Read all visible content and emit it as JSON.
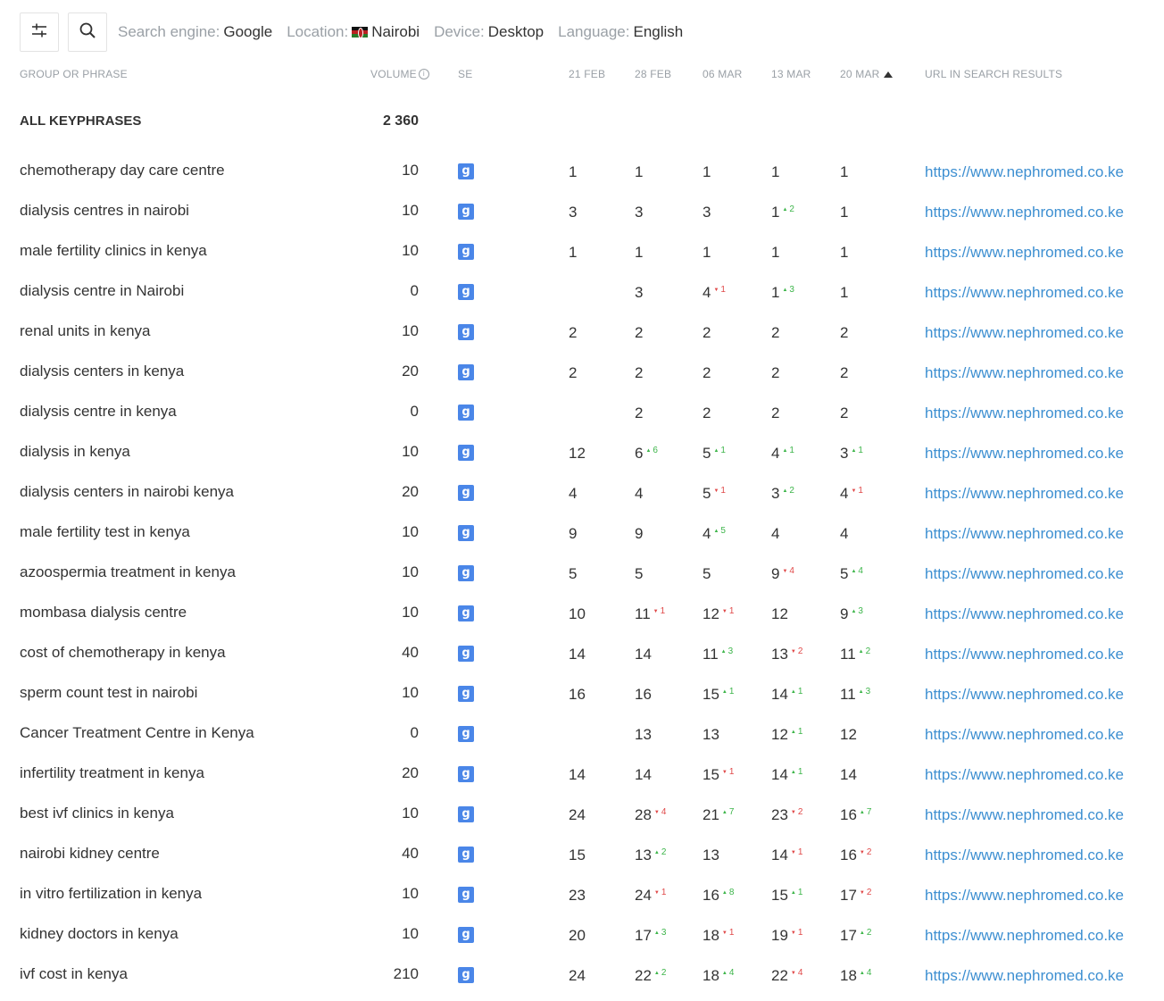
{
  "toolbar": {
    "filter_settings_icon": "sliders-icon",
    "search_icon": "search-icon",
    "search_engine_label": "Search engine:",
    "search_engine": "Google",
    "location_label": "Location:",
    "location": "Nairobi",
    "device_label": "Device:",
    "device": "Desktop",
    "language_label": "Language:",
    "language": "English"
  },
  "columns": {
    "phrase": "GROUP OR PHRASE",
    "volume": "VOLUME",
    "se": "SE",
    "dates": [
      "21 FEB",
      "28 FEB",
      "06 MAR",
      "13 MAR",
      "20 MAR"
    ],
    "url": "URL IN SEARCH RESULTS"
  },
  "summary": {
    "label": "ALL KEYPHRASES",
    "volume": "2 360"
  },
  "se_icon_letter": "g",
  "colors": {
    "up": "#3db54a",
    "down": "#e04848",
    "link": "#3d8fd1",
    "se_badge": "#4a86e8"
  },
  "rows": [
    {
      "phrase": "chemotherapy day care centre",
      "volume": "10",
      "pos": [
        {
          "v": "1"
        },
        {
          "v": "1"
        },
        {
          "v": "1"
        },
        {
          "v": "1"
        },
        {
          "v": "1"
        }
      ],
      "url": "https://www.nephromed.co.ke"
    },
    {
      "phrase": "dialysis centres in nairobi",
      "volume": "10",
      "pos": [
        {
          "v": "3"
        },
        {
          "v": "3"
        },
        {
          "v": "3"
        },
        {
          "v": "1",
          "c": "2",
          "d": "up"
        },
        {
          "v": "1"
        }
      ],
      "url": "https://www.nephromed.co.ke"
    },
    {
      "phrase": "male fertility clinics in kenya",
      "volume": "10",
      "pos": [
        {
          "v": "1"
        },
        {
          "v": "1"
        },
        {
          "v": "1"
        },
        {
          "v": "1"
        },
        {
          "v": "1"
        }
      ],
      "url": "https://www.nephromed.co.ke"
    },
    {
      "phrase": "dialysis centre in Nairobi",
      "volume": "0",
      "pos": [
        {
          "v": ""
        },
        {
          "v": "3"
        },
        {
          "v": "4",
          "c": "1",
          "d": "down"
        },
        {
          "v": "1",
          "c": "3",
          "d": "up"
        },
        {
          "v": "1"
        }
      ],
      "url": "https://www.nephromed.co.ke"
    },
    {
      "phrase": "renal units in kenya",
      "volume": "10",
      "pos": [
        {
          "v": "2"
        },
        {
          "v": "2"
        },
        {
          "v": "2"
        },
        {
          "v": "2"
        },
        {
          "v": "2"
        }
      ],
      "url": "https://www.nephromed.co.ke"
    },
    {
      "phrase": "dialysis centers in kenya",
      "volume": "20",
      "pos": [
        {
          "v": "2"
        },
        {
          "v": "2"
        },
        {
          "v": "2"
        },
        {
          "v": "2"
        },
        {
          "v": "2"
        }
      ],
      "url": "https://www.nephromed.co.ke"
    },
    {
      "phrase": "dialysis centre in kenya",
      "volume": "0",
      "pos": [
        {
          "v": ""
        },
        {
          "v": "2"
        },
        {
          "v": "2"
        },
        {
          "v": "2"
        },
        {
          "v": "2"
        }
      ],
      "url": "https://www.nephromed.co.ke"
    },
    {
      "phrase": "dialysis in kenya",
      "volume": "10",
      "pos": [
        {
          "v": "12"
        },
        {
          "v": "6",
          "c": "6",
          "d": "up"
        },
        {
          "v": "5",
          "c": "1",
          "d": "up"
        },
        {
          "v": "4",
          "c": "1",
          "d": "up"
        },
        {
          "v": "3",
          "c": "1",
          "d": "up"
        }
      ],
      "url": "https://www.nephromed.co.ke"
    },
    {
      "phrase": "dialysis centers in nairobi kenya",
      "volume": "20",
      "pos": [
        {
          "v": "4"
        },
        {
          "v": "4"
        },
        {
          "v": "5",
          "c": "1",
          "d": "down"
        },
        {
          "v": "3",
          "c": "2",
          "d": "up"
        },
        {
          "v": "4",
          "c": "1",
          "d": "down"
        }
      ],
      "url": "https://www.nephromed.co.ke"
    },
    {
      "phrase": "male fertility test in kenya",
      "volume": "10",
      "pos": [
        {
          "v": "9"
        },
        {
          "v": "9"
        },
        {
          "v": "4",
          "c": "5",
          "d": "up"
        },
        {
          "v": "4"
        },
        {
          "v": "4"
        }
      ],
      "url": "https://www.nephromed.co.ke"
    },
    {
      "phrase": "azoospermia treatment in kenya",
      "volume": "10",
      "pos": [
        {
          "v": "5"
        },
        {
          "v": "5"
        },
        {
          "v": "5"
        },
        {
          "v": "9",
          "c": "4",
          "d": "down"
        },
        {
          "v": "5",
          "c": "4",
          "d": "up"
        }
      ],
      "url": "https://www.nephromed.co.ke"
    },
    {
      "phrase": "mombasa dialysis centre",
      "volume": "10",
      "pos": [
        {
          "v": "10"
        },
        {
          "v": "11",
          "c": "1",
          "d": "down"
        },
        {
          "v": "12",
          "c": "1",
          "d": "down"
        },
        {
          "v": "12"
        },
        {
          "v": "9",
          "c": "3",
          "d": "up"
        }
      ],
      "url": "https://www.nephromed.co.ke"
    },
    {
      "phrase": "cost of chemotherapy in kenya",
      "volume": "40",
      "pos": [
        {
          "v": "14"
        },
        {
          "v": "14"
        },
        {
          "v": "11",
          "c": "3",
          "d": "up"
        },
        {
          "v": "13",
          "c": "2",
          "d": "down"
        },
        {
          "v": "11",
          "c": "2",
          "d": "up"
        }
      ],
      "url": "https://www.nephromed.co.ke"
    },
    {
      "phrase": "sperm count test in nairobi",
      "volume": "10",
      "pos": [
        {
          "v": "16"
        },
        {
          "v": "16"
        },
        {
          "v": "15",
          "c": "1",
          "d": "up"
        },
        {
          "v": "14",
          "c": "1",
          "d": "up"
        },
        {
          "v": "11",
          "c": "3",
          "d": "up"
        }
      ],
      "url": "https://www.nephromed.co.ke"
    },
    {
      "phrase": "Cancer Treatment Centre in Kenya",
      "volume": "0",
      "pos": [
        {
          "v": ""
        },
        {
          "v": "13"
        },
        {
          "v": "13"
        },
        {
          "v": "12",
          "c": "1",
          "d": "up"
        },
        {
          "v": "12"
        }
      ],
      "url": "https://www.nephromed.co.ke"
    },
    {
      "phrase": "infertility treatment in kenya",
      "volume": "20",
      "pos": [
        {
          "v": "14"
        },
        {
          "v": "14"
        },
        {
          "v": "15",
          "c": "1",
          "d": "down"
        },
        {
          "v": "14",
          "c": "1",
          "d": "up"
        },
        {
          "v": "14"
        }
      ],
      "url": "https://www.nephromed.co.ke"
    },
    {
      "phrase": "best ivf clinics in kenya",
      "volume": "10",
      "pos": [
        {
          "v": "24"
        },
        {
          "v": "28",
          "c": "4",
          "d": "down"
        },
        {
          "v": "21",
          "c": "7",
          "d": "up"
        },
        {
          "v": "23",
          "c": "2",
          "d": "down"
        },
        {
          "v": "16",
          "c": "7",
          "d": "up"
        }
      ],
      "url": "https://www.nephromed.co.ke"
    },
    {
      "phrase": "nairobi kidney centre",
      "volume": "40",
      "pos": [
        {
          "v": "15"
        },
        {
          "v": "13",
          "c": "2",
          "d": "up"
        },
        {
          "v": "13"
        },
        {
          "v": "14",
          "c": "1",
          "d": "down"
        },
        {
          "v": "16",
          "c": "2",
          "d": "down"
        }
      ],
      "url": "https://www.nephromed.co.ke"
    },
    {
      "phrase": "in vitro fertilization in kenya",
      "volume": "10",
      "pos": [
        {
          "v": "23"
        },
        {
          "v": "24",
          "c": "1",
          "d": "down"
        },
        {
          "v": "16",
          "c": "8",
          "d": "up"
        },
        {
          "v": "15",
          "c": "1",
          "d": "up"
        },
        {
          "v": "17",
          "c": "2",
          "d": "down"
        }
      ],
      "url": "https://www.nephromed.co.ke"
    },
    {
      "phrase": "kidney doctors in kenya",
      "volume": "10",
      "pos": [
        {
          "v": "20"
        },
        {
          "v": "17",
          "c": "3",
          "d": "up"
        },
        {
          "v": "18",
          "c": "1",
          "d": "down"
        },
        {
          "v": "19",
          "c": "1",
          "d": "down"
        },
        {
          "v": "17",
          "c": "2",
          "d": "up"
        }
      ],
      "url": "https://www.nephromed.co.ke"
    },
    {
      "phrase": "ivf cost in kenya",
      "volume": "210",
      "pos": [
        {
          "v": "24"
        },
        {
          "v": "22",
          "c": "2",
          "d": "up"
        },
        {
          "v": "18",
          "c": "4",
          "d": "up"
        },
        {
          "v": "22",
          "c": "4",
          "d": "down"
        },
        {
          "v": "18",
          "c": "4",
          "d": "up"
        }
      ],
      "url": "https://www.nephromed.co.ke"
    }
  ]
}
